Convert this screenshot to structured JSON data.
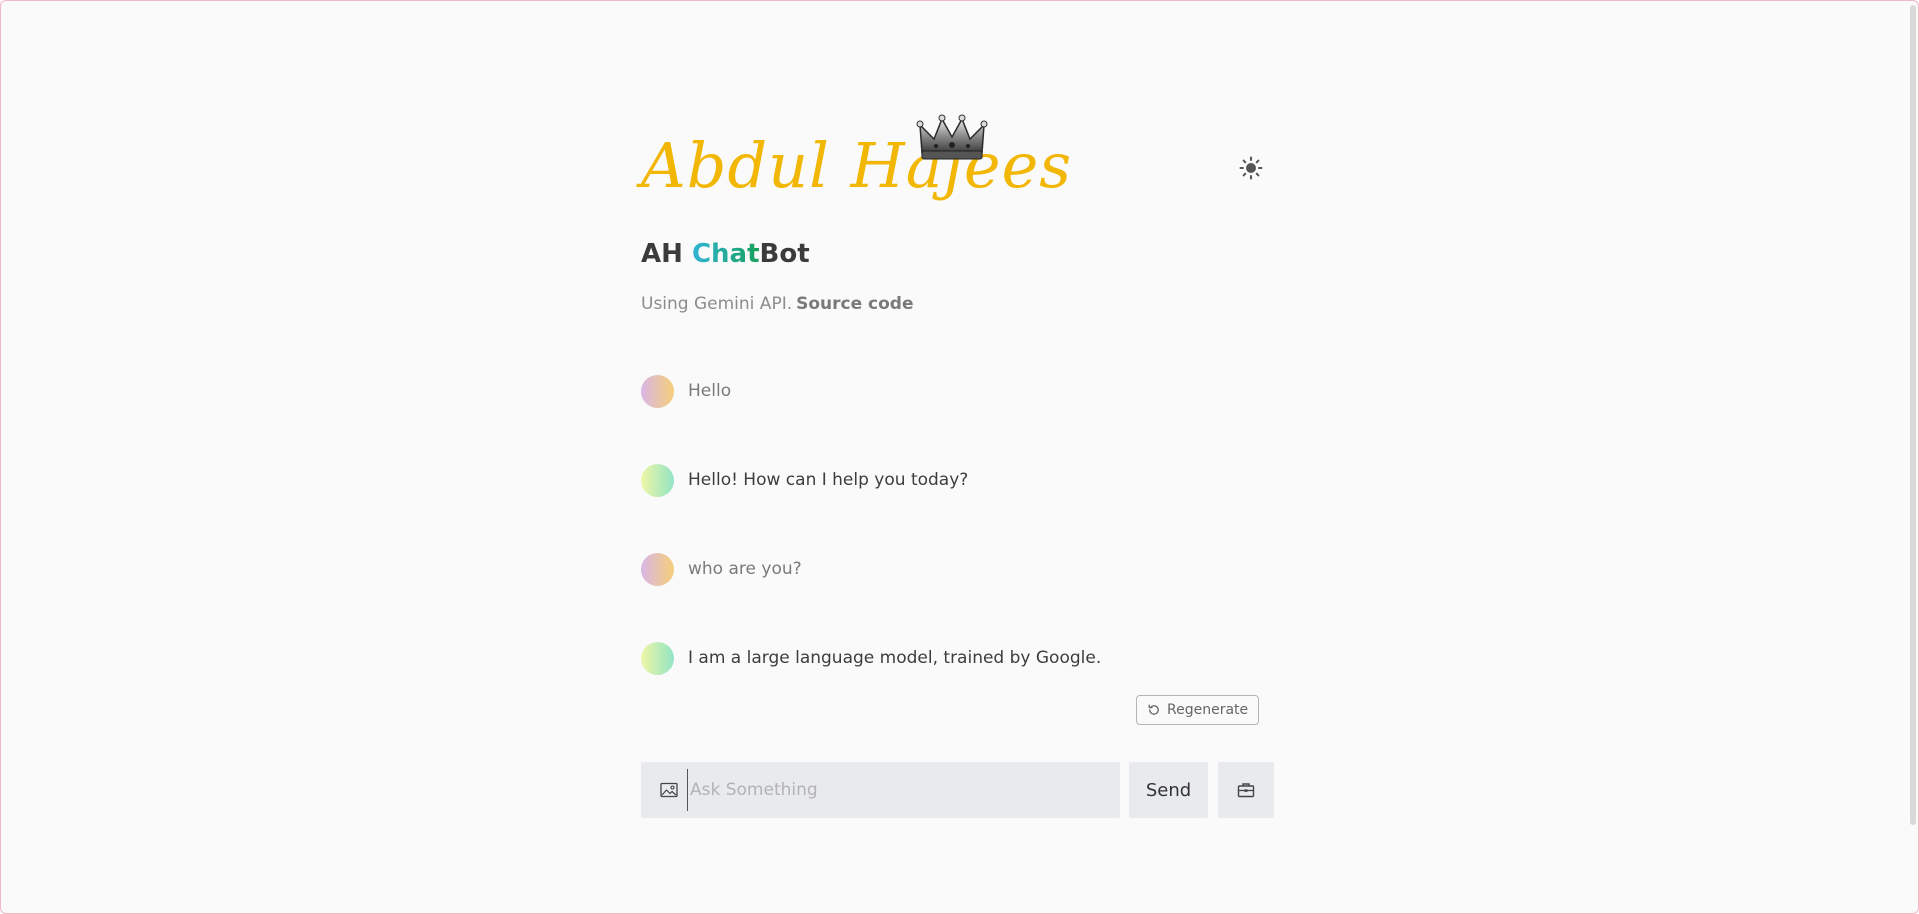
{
  "logo": {
    "text": "Abdul Hajees"
  },
  "header": {
    "title_prefix": "AH ",
    "title_highlight": "Chat",
    "title_suffix": "Bot",
    "subtitle": "Using Gemini API.",
    "source_link": "Source code"
  },
  "messages": [
    {
      "role": "user",
      "text": "Hello"
    },
    {
      "role": "model",
      "text": "Hello! How can I help you today?"
    },
    {
      "role": "user",
      "text": "who are you?"
    },
    {
      "role": "model",
      "text": "I am a large language model, trained by Google."
    }
  ],
  "actions": {
    "regenerate_label": "Regenerate"
  },
  "composer": {
    "placeholder": "Ask Something",
    "value": "",
    "send_label": "Send"
  },
  "colors": {
    "background": "#fafafa",
    "logo": "#f2b705",
    "chat_gradient_start": "#2fb5d6",
    "chat_gradient_end": "#18a05a",
    "input_bg": "#e8eaed"
  },
  "icons": {
    "theme_toggle": "sun-icon",
    "image_upload": "image-icon",
    "regenerate": "refresh-icon",
    "clear": "briefcase-icon",
    "crown": "crown-icon"
  }
}
